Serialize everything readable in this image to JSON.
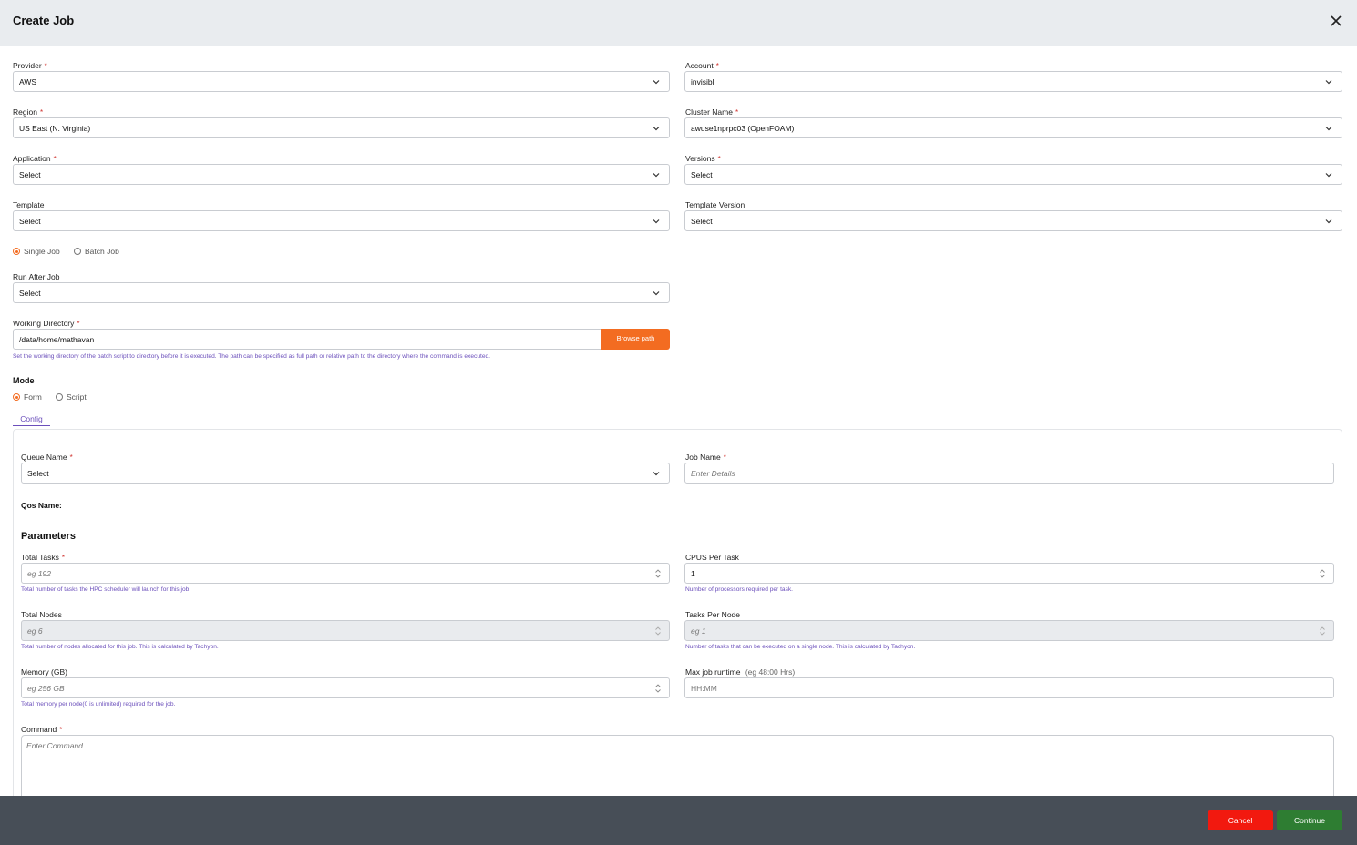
{
  "header": {
    "title": "Create Job"
  },
  "fields": {
    "provider": {
      "label": "Provider",
      "value": "AWS"
    },
    "account": {
      "label": "Account",
      "value": "invisibl"
    },
    "region": {
      "label": "Region",
      "value": "US East (N. Virginia)"
    },
    "cluster_name": {
      "label": "Cluster Name",
      "value": "awuse1nprpc03 (OpenFOAM)"
    },
    "application": {
      "label": "Application",
      "value": "Select"
    },
    "versions": {
      "label": "Versions",
      "value": "Select"
    },
    "template": {
      "label": "Template",
      "value": "Select"
    },
    "template_version": {
      "label": "Template Version",
      "value": "Select"
    },
    "run_after_job": {
      "label": "Run After Job",
      "value": "Select"
    },
    "working_directory": {
      "label": "Working Directory",
      "value": "/data/home/mathavan",
      "browse_label": "Browse path",
      "help": "Set the working directory of the batch script to directory before it is executed. The path can be specified as full path or relative path to the directory where the command is executed."
    }
  },
  "job_type": {
    "single": "Single Job",
    "batch": "Batch Job",
    "selected": "single"
  },
  "mode": {
    "label": "Mode",
    "form": "Form",
    "script": "Script",
    "selected": "form"
  },
  "tabs": {
    "config": "Config"
  },
  "config": {
    "queue_name": {
      "label": "Queue Name",
      "value": "Select"
    },
    "job_name": {
      "label": "Job Name",
      "placeholder": "Enter Details"
    },
    "qos_label": "Qos Name:",
    "parameters_title": "Parameters",
    "total_tasks": {
      "label": "Total Tasks",
      "placeholder": "eg 192",
      "help": "Total number of tasks the HPC scheduler will launch for this job."
    },
    "cpus_per_task": {
      "label": "CPUS Per Task",
      "value": "1",
      "help": "Number of processors required per task."
    },
    "total_nodes": {
      "label": "Total Nodes",
      "placeholder": "eg 6",
      "help": "Total number of nodes allocated for this job. This is calculated by Tachyon."
    },
    "tasks_per_node": {
      "label": "Tasks Per Node",
      "placeholder": "eg 1",
      "help": "Number of tasks that can be executed on a single node. This is calculated by Tachyon."
    },
    "memory": {
      "label": "Memory (GB)",
      "placeholder": "eg 256 GB",
      "help": "Total memory per node(0 is unlimited) required for the job."
    },
    "max_runtime": {
      "label": "Max job runtime",
      "hint": "(eg 48:00 Hrs)",
      "placeholder": "HH:MM"
    },
    "command": {
      "label": "Command",
      "placeholder": "Enter Command"
    }
  },
  "footer": {
    "cancel": "Cancel",
    "continue": "Continue"
  },
  "colors": {
    "accent": "#f36c21",
    "required": "#d0312d",
    "help": "#6b4fbb",
    "cancel": "#f2190f",
    "continue": "#2e7d32",
    "footer": "#474e57"
  }
}
